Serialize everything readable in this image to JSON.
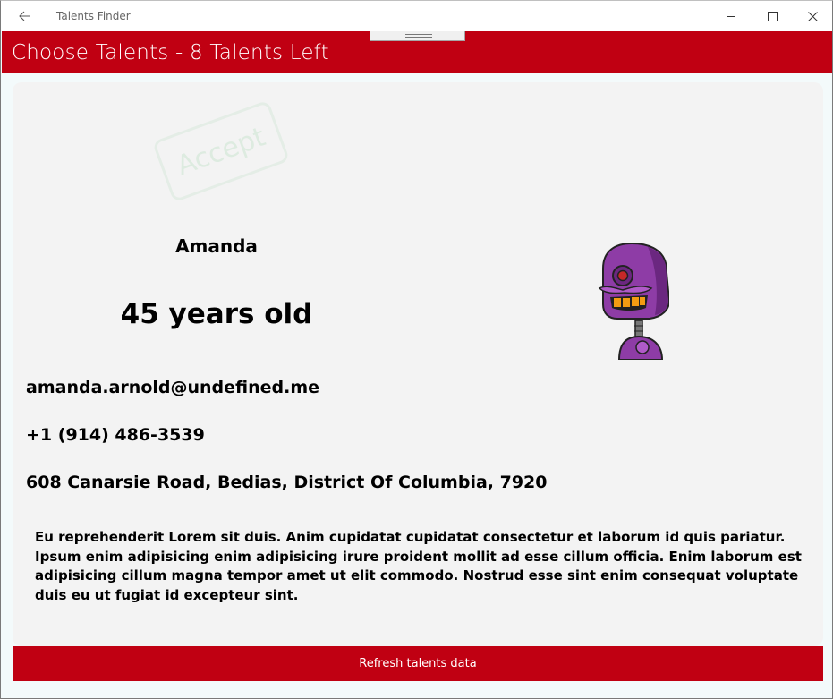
{
  "window": {
    "title": "Talents Finder",
    "back_icon": "back-arrow-icon",
    "minimize_icon": "minimize-icon",
    "maximize_icon": "maximize-icon",
    "close_icon": "close-icon"
  },
  "header": {
    "title": "Choose Talents - 8 Talents Left",
    "background": "#c00012"
  },
  "card": {
    "stamp_text": "Accept",
    "name": "Amanda",
    "age": "45 years old",
    "email": "amanda.arnold@undefined.me",
    "phone": "+1 (914) 486-3539",
    "address": "608 Canarsie Road, Bedias, District Of Columbia, 7920",
    "about": "Eu reprehenderit Lorem sit duis. Anim cupidatat cupidatat consectetur et laborum id quis pariatur. Ipsum enim adipisicing enim adipisicing irure proident mollit ad esse cillum officia. Enim laborum est adipisicing cillum magna tempor amet ut elit commodo. Nostrud esse sint enim consequat voluptate duis eu ut fugiat id excepteur sint.",
    "avatar_icon": "robot-avatar-icon"
  },
  "actions": {
    "refresh_label": "Refresh talents data"
  },
  "colors": {
    "accent": "#c00012",
    "card_bg": "#f3f3f3",
    "avatar_purple": "#8e3ca6"
  }
}
